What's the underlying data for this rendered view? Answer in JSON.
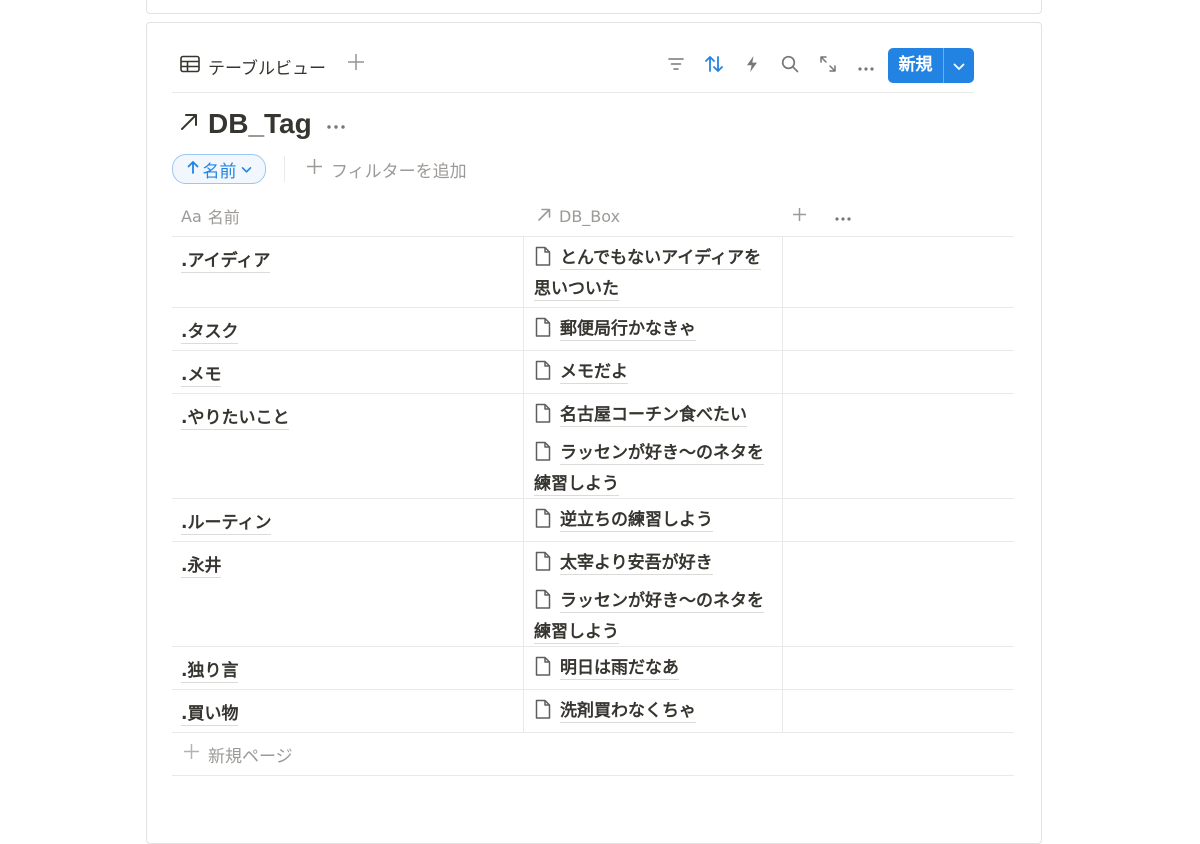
{
  "view": {
    "tab_label": "テーブルビュー",
    "tab_icon": "table-icon",
    "add_icon": "plus-icon"
  },
  "toolbar": {
    "icons": [
      "filter-icon",
      "sort-icon",
      "automation-icon",
      "search-icon",
      "expand-icon",
      "more-icon"
    ],
    "new_label": "新規",
    "accent": "#2383e2"
  },
  "database": {
    "title": "DB_Tag"
  },
  "filters": {
    "sort_label": "名前",
    "add_filter_label": "フィルターを追加"
  },
  "table": {
    "columns": [
      {
        "type_label": "Aa",
        "label": "名前"
      },
      {
        "label": "DB_Box"
      }
    ],
    "rows": [
      {
        "name": ".アイディア",
        "relations": [
          "とんでもないアイディアを思いついた"
        ]
      },
      {
        "name": ".タスク",
        "relations": [
          "郵便局行かなきゃ"
        ]
      },
      {
        "name": ".メモ",
        "relations": [
          "メモだよ"
        ]
      },
      {
        "name": ".やりたいこと",
        "relations": [
          "名古屋コーチン食べたい",
          "ラッセンが好き〜のネタを練習しよう"
        ]
      },
      {
        "name": ".ルーティン",
        "relations": [
          "逆立ちの練習しよう"
        ]
      },
      {
        "name": ".永井",
        "relations": [
          "太宰より安吾が好き",
          "ラッセンが好き〜のネタを練習しよう"
        ]
      },
      {
        "name": ".独り言",
        "relations": [
          "明日は雨だなあ"
        ]
      },
      {
        "name": ".買い物",
        "relations": [
          "洗剤買わなくちゃ"
        ]
      }
    ],
    "new_page_label": "新規ページ"
  }
}
